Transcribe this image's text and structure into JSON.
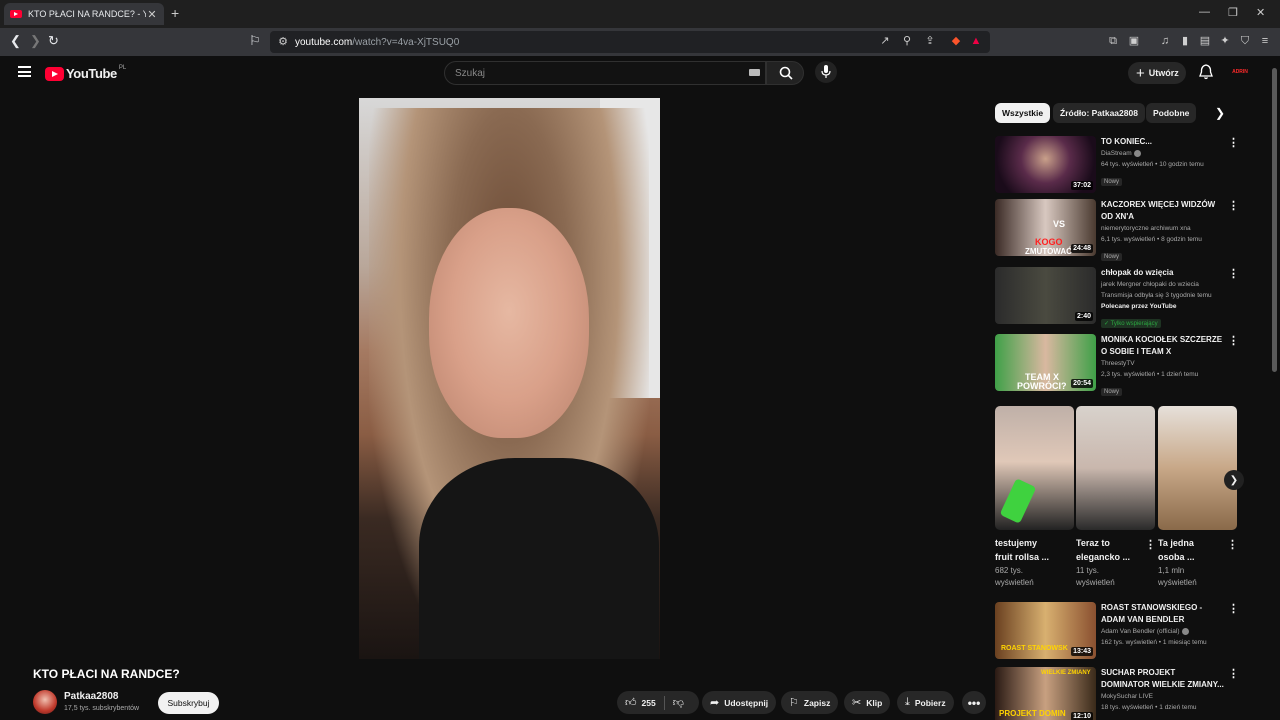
{
  "browser": {
    "tab_title": "KTO PŁACI NA RANDCE? - YouTu",
    "url_host": "youtube.com",
    "url_path": "/watch?v=4va-XjTSUQ0"
  },
  "header": {
    "logo_text": "YouTube",
    "country": "PL",
    "search_placeholder": "Szukaj",
    "create_label": "Utwórz",
    "avatar_text": "ADRIN"
  },
  "video": {
    "title": "KTO PŁACI NA RANDCE?",
    "channel": "Patkaa2808",
    "subscribers": "17,5 tys. subskrybentów",
    "subscribe_label": "Subskrybuj",
    "likes": "255",
    "share_label": "Udostępnij",
    "save_label": "Zapisz",
    "clip_label": "Klip",
    "download_label": "Pobierz"
  },
  "chips": [
    "Wszystkie",
    "Źródło: Patkaa2808",
    "Podobne"
  ],
  "recommendations": [
    {
      "title": "TO KONIEC...",
      "channel": "DiaStream",
      "verified": true,
      "meta": "64 tys. wyświetleń • 10 godzin temu",
      "badge": "Nowy",
      "duration": "37:02"
    },
    {
      "title": "KACZOREX WIĘCEJ WIDZÓW OD XN'A",
      "channel": "niemerytoryczne archiwum xna",
      "meta": "6,1 tys. wyświetleń • 8 godzin temu",
      "badge": "Nowy",
      "duration": "24:48"
    },
    {
      "title": "chłopak do wzięcia",
      "channel": "jarek Mergner chłopaki do wziecia",
      "meta": "Transmisja odbyła się 3 tygodnie temu",
      "recommended": "Polecane przez YouTube",
      "member": "Tylko wspierający",
      "duration": "2:40"
    },
    {
      "title": "MONIKA KOCIOŁEK SZCZERZE O SOBIE I TEAM X",
      "channel": "ThreestyTV",
      "meta": "2,3 tys. wyświetleń • 1 dzień temu",
      "badge": "Nowy",
      "duration": "20:54"
    },
    {
      "title": "ROAST STANOWSKIEGO - ADAM VAN BENDLER",
      "channel": "Adam Van Bendler (official)",
      "verified": true,
      "meta": "162 tys. wyświetleń • 1 miesiąc temu",
      "duration": "13:43"
    },
    {
      "title": "SUCHAR PROJEKT DOMINATOR WIELKIE ZMIANY...",
      "channel": "MokySuchar LIVE",
      "meta": "18 tys. wyświetleń • 1 dzień temu",
      "duration": "12:10"
    }
  ],
  "shorts": [
    {
      "title1": "testujemy",
      "title2": "fruit rollsa ...",
      "views1": "682 tys.",
      "views2": "wyświetleń"
    },
    {
      "title1": "Teraz to",
      "title2": "elegancko ...",
      "views1": "11 tys.",
      "views2": "wyświetleń"
    },
    {
      "title1": "Ta jedna",
      "title2": "osoba ...",
      "views1": "1,1 mln",
      "views2": "wyświetleń"
    }
  ],
  "thumb_text": {
    "kaczorex_vs": "VS",
    "kaczorex_line1": "KOGO",
    "kaczorex_line2": "ZMUTOWAĆ",
    "teamx_line1": "TEAM X",
    "teamx_line2": "POWRÓCI?",
    "roast": "ROAST STANOWSK",
    "suchar": "WIELKIE ZMIANY",
    "suchar_bottom": "PROJEKT DOMIN"
  },
  "colors": {
    "brand_red": "#ff0033",
    "bg": "#0f0f0f",
    "chip": "#272727"
  }
}
